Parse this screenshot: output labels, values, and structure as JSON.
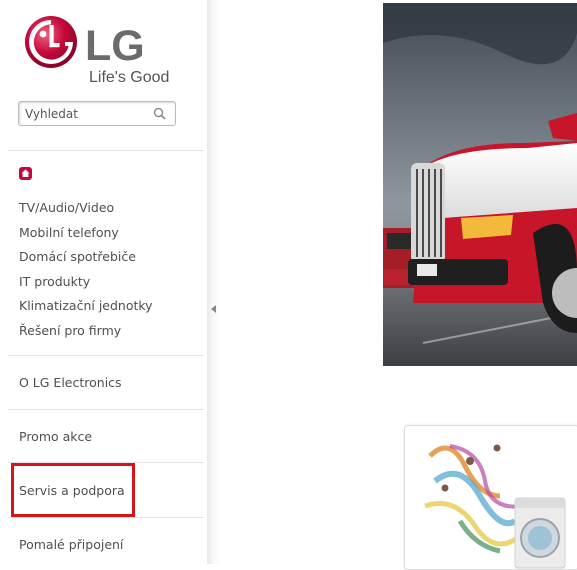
{
  "logo": {
    "brand": "LG",
    "tagline": "Life's Good"
  },
  "search": {
    "placeholder": "Vyhledat",
    "icon": "search-icon"
  },
  "home": {
    "icon": "home-icon"
  },
  "nav": {
    "items": [
      {
        "label": "TV/Audio/Video"
      },
      {
        "label": "Mobilní telefony"
      },
      {
        "label": "Domácí spotřebiče"
      },
      {
        "label": "IT produkty"
      },
      {
        "label": "Klimatizační jednotky"
      },
      {
        "label": "Řešení pro firmy"
      }
    ]
  },
  "links": {
    "about": "O LG Electronics",
    "promo": "Promo akce",
    "service": "Servis a podpora",
    "slow": "Pomalé připojení"
  },
  "colors": {
    "accent": "#c6093b",
    "highlight": "#d5141c",
    "text": "#4f4f4f"
  }
}
